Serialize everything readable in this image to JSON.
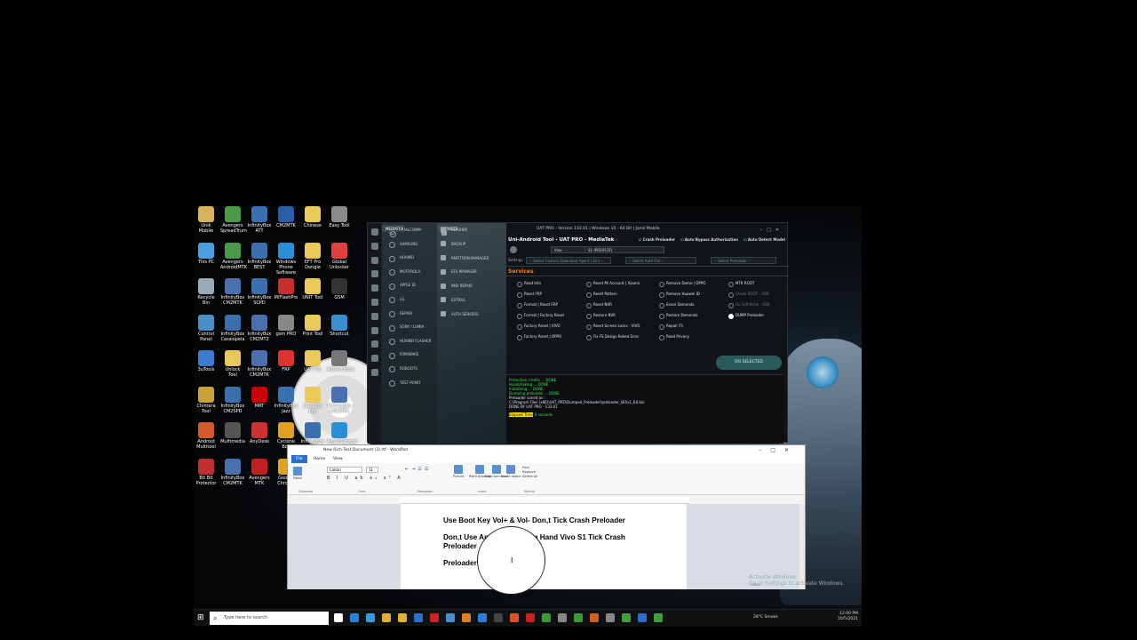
{
  "desktop": {
    "icons_left": [
      {
        "label": "Unik Mobile",
        "color": "#d9b35a"
      },
      {
        "label": "Avengers SpreadTrum",
        "color": "#4a9a4a"
      },
      {
        "label": "InfinityBox ATT",
        "color": "#3a6fb0"
      },
      {
        "label": "CM2MTK",
        "color": "#2a5fa8"
      },
      {
        "label": "Chinese",
        "color": "#e8c95a"
      },
      {
        "label": "Easy Tool",
        "color": "#8a8a8a"
      },
      {
        "label": "This PC",
        "color": "#4aa0e0"
      },
      {
        "label": "Avengers AndroidMTK",
        "color": "#4a9a4a"
      },
      {
        "label": "InfinityBox BEST",
        "color": "#3a6fb0"
      },
      {
        "label": "Windows Phone Software",
        "color": "#2a8fd8"
      },
      {
        "label": "EFT Pro Dongle",
        "color": "#e8c95a"
      },
      {
        "label": "Global Unlocker",
        "color": "#e04040"
      },
      {
        "label": "Recycle Bin",
        "color": "#9ab"
      },
      {
        "label": "InfinityBox CM2MTK",
        "color": "#4a70b0"
      },
      {
        "label": "InfinityBox SCPD",
        "color": "#3a6fb0"
      },
      {
        "label": "MiFlashPro",
        "color": "#c83030"
      },
      {
        "label": "UNIT Tool",
        "color": "#e8c95a"
      },
      {
        "label": "GSM",
        "color": "#333"
      },
      {
        "label": "Control Panel",
        "color": "#4a90c8"
      },
      {
        "label": "InfinityBox Cassiopeia",
        "color": "#3a6fb0"
      },
      {
        "label": "InfinityBox CM2MT2",
        "color": "#4a70b0"
      },
      {
        "label": "gsm PRO",
        "color": "#888"
      },
      {
        "label": "Print Tool",
        "color": "#e8c95a"
      },
      {
        "label": "Shortcut",
        "color": "#3a8fd0"
      },
      {
        "label": "3uTools",
        "color": "#3a7ad0"
      },
      {
        "label": "Unlock Tool",
        "color": "#e8c95a"
      },
      {
        "label": "InfinityBox CM2MTK",
        "color": "#4a70b0"
      },
      {
        "label": "FRP",
        "color": "#d33"
      },
      {
        "label": "UAT Pro",
        "color": "#e8c95a"
      },
      {
        "label": "AdvanceBox",
        "color": "#777"
      },
      {
        "label": "Chimera Tool",
        "color": "#c9a23a"
      },
      {
        "label": "InfinityBox CM2SPD",
        "color": "#3a6fb0"
      },
      {
        "label": "MRT",
        "color": "#c00"
      },
      {
        "label": "InfinityBox Jazz",
        "color": "#3a6fb0"
      },
      {
        "label": "Jazz digi Key",
        "color": "#e8c95a"
      },
      {
        "label": "InfinityBox CM2MTK",
        "color": "#4a70b0"
      },
      {
        "label": "Android Multitool",
        "color": "#d45a2a"
      },
      {
        "label": "Multimedia",
        "color": "#555"
      },
      {
        "label": "AnyDesk",
        "color": "#d03030"
      },
      {
        "label": "Cyclone Box",
        "color": "#e0a020"
      },
      {
        "label": "InfinityBox SCD",
        "color": "#3a6fb0"
      },
      {
        "label": "AquaManager",
        "color": "#2a8fd8"
      },
      {
        "label": "Bit Bit Protector",
        "color": "#c03030"
      },
      {
        "label": "InfinityBox CM2MTK",
        "color": "#4a70b0"
      },
      {
        "label": "Avengers MTK",
        "color": "#c02020"
      },
      {
        "label": "Google Chrome",
        "color": "#e0a020"
      },
      {
        "label": "InfinityBox HMS",
        "color": "#3a6fb0"
      },
      {
        "label": "Samsung MTK",
        "color": "#888"
      }
    ]
  },
  "uat": {
    "window_title": "UAT PRO - Version 133.01 | Windows 10 - 64 Bit | Jamil Mobile",
    "app_title": "Uni-Android Tool - UAT PRO - MediaTek",
    "options": [
      "Crash Preloader",
      "Auto Bypass Authorization",
      "Auto Detect Model"
    ],
    "brand": "Vivo",
    "model": "S1 (PD1913F)",
    "settings_label": "Settings",
    "da_placeholder": "-- Select Custom Download Agent (.bin) --",
    "auth_placeholder": "-- Select Auth File --",
    "preloader_placeholder": "-- Select Preloader --",
    "nav_primary": [
      "QUALCOMM",
      "MEDIATEK",
      "SAMSUNG",
      "HUAWEI",
      "MOTOROLA",
      "APPLE ID",
      "LG",
      "REPAIR",
      "SONY / LUMIA",
      "HUAWEI FLASHER",
      "FIRMWARE",
      "ROBOOTS",
      "TEST POINT"
    ],
    "nav_secondary": [
      "SERVICES",
      "FLASHER",
      "BACKUP",
      "PARTITION MANAGER",
      "EFS MANAGER",
      "IMEI REPAIR",
      "EXTRAS",
      "AUTH SERVERS"
    ],
    "services_heading": "Services",
    "services": [
      {
        "label": "Read Info",
        "state": "normal"
      },
      {
        "label": "Reset Mi Account | Xiaomi",
        "state": "normal"
      },
      {
        "label": "Remove Demo | OPPO",
        "state": "normal"
      },
      {
        "label": "MTK ROOT",
        "state": "normal"
      },
      {
        "label": "Reset FRP",
        "state": "normal"
      },
      {
        "label": "Reset Pattern",
        "state": "normal"
      },
      {
        "label": "Remove Huawei ID",
        "state": "normal"
      },
      {
        "label": "Check ROOT - ADB",
        "state": "dim"
      },
      {
        "label": "Format | Reset FRP",
        "state": "normal"
      },
      {
        "label": "Reset NVR",
        "state": "normal"
      },
      {
        "label": "Erase Demonds",
        "state": "normal"
      },
      {
        "label": "Fix Soft-Brick - ADB",
        "state": "dim"
      },
      {
        "label": "Format | Factory Reset",
        "state": "normal"
      },
      {
        "label": "Restore NVR",
        "state": "normal"
      },
      {
        "label": "Restore Demonds",
        "state": "normal"
      },
      {
        "label": "DUMP Preloader",
        "state": "on"
      },
      {
        "label": "Factory Reset | VIVO",
        "state": "normal"
      },
      {
        "label": "Reset Screen Locks - VIVO",
        "state": "normal"
      },
      {
        "label": "Repair FS",
        "state": "normal"
      },
      {
        "label": "Factory Reset | OPPO",
        "state": "normal"
      },
      {
        "label": "Fix FS Design Relied Error",
        "state": "normal"
      },
      {
        "label": "Read Privacy",
        "state": "normal"
      }
    ],
    "do_selected": "DO SELECTED",
    "log": [
      {
        "text": "Protection credits ... DONE",
        "ok": true
      },
      {
        "text": "Handshaking ... DONE",
        "ok": true
      },
      {
        "text": "Initializing ... DONE",
        "ok": true
      },
      {
        "text": "Dumping preloader ... DONE",
        "ok": true
      },
      {
        "text": "Preloader saved as :",
        "ok": false
      },
      {
        "text": "C:\\Program Files (x86)\\UAT_PRO\\Dumped_Preloader\\preloader_k65v1_64.bin",
        "ok": false
      },
      {
        "text": "",
        "ok": false
      },
      {
        "text": "DONE BY UAT PRO - 133.01",
        "ok": false
      }
    ],
    "elapsed_label": "Elapsed Time",
    "elapsed_value": "0 seconds"
  },
  "wordpad": {
    "title": "New Rich Text Document (3).rtf - WordPad",
    "tabs": [
      "File",
      "Home",
      "View"
    ],
    "font": "Calibri",
    "size": "11",
    "ribbon_buttons": [
      "Paste",
      "Picture",
      "Paint drawing",
      "Date and time",
      "Insert object",
      "Find",
      "Replace",
      "Select all"
    ],
    "groups": [
      "Clipboard",
      "Font",
      "Paragraph",
      "Insert",
      "Editing"
    ],
    "paragraphs": [
      "Use Boot Key Vol+ & Vol- Don,t Tick Crash Preloader",
      "Don,t Use Any Test Point In Hand Vivo S1 Tick Crash Preloader",
      "Preloader"
    ],
    "zoom": "100%"
  },
  "watermark": [
    "Activate Windows",
    "Go to Settings to activate Windows."
  ],
  "taskbar": {
    "search_placeholder": "Type here to search",
    "weather": "28°C Smoke",
    "time": "12:00 PM",
    "date": "10/5/2021"
  }
}
